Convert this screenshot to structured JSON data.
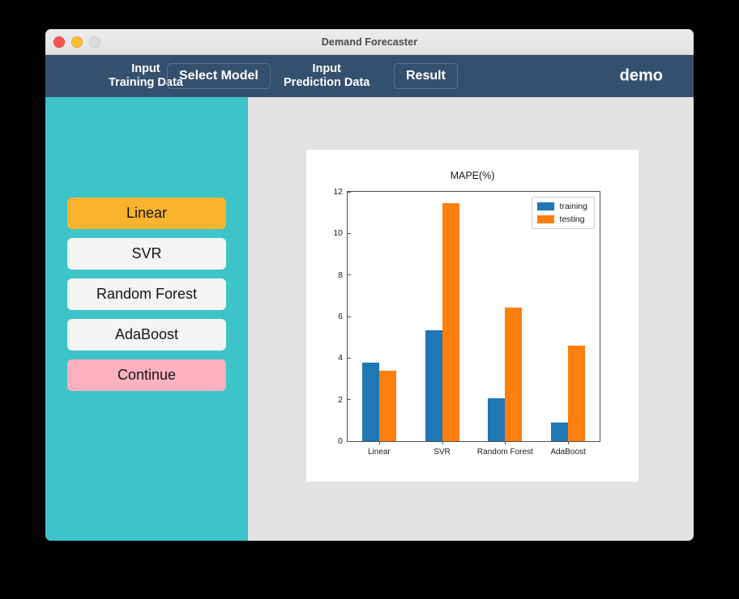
{
  "window": {
    "title": "Demand Forecaster",
    "traffic_lights": [
      "close",
      "minimize",
      "maximize"
    ]
  },
  "nav": {
    "input_training_data": "Input\nTraining Data",
    "select_model": "Select Model",
    "input_prediction_data": "Input\nPrediction Data",
    "result": "Result",
    "brand": "demo"
  },
  "sidebar": {
    "buttons": [
      {
        "label": "Linear",
        "state": "selected"
      },
      {
        "label": "SVR",
        "state": "normal"
      },
      {
        "label": "Random Forest",
        "state": "normal"
      },
      {
        "label": "AdaBoost",
        "state": "normal"
      },
      {
        "label": "Continue",
        "state": "continue"
      }
    ]
  },
  "colors": {
    "sidebar": "#3cc4c9",
    "navbar": "#35506e",
    "selected_button": "#f9b32f",
    "continue_button": "#fbb1c0",
    "normal_button": "#f4f4f4",
    "content_background": "#e2e2e2",
    "series_training": "#1f77b4",
    "series_testing": "#ff7f0e"
  },
  "chart_data": {
    "type": "bar",
    "title": "MAPE(%)",
    "xlabel": "",
    "ylabel": "",
    "ylim": [
      0,
      12
    ],
    "yticks": [
      0,
      2,
      4,
      6,
      8,
      10,
      12
    ],
    "grid": false,
    "legend_position": "upper right",
    "categories": [
      "Linear",
      "SVR",
      "Random Forest",
      "AdaBoost"
    ],
    "series": [
      {
        "name": "training",
        "color": "#1f77b4",
        "values": [
          3.77,
          5.35,
          2.05,
          0.88
        ]
      },
      {
        "name": "testing",
        "color": "#ff7f0e",
        "values": [
          3.4,
          11.47,
          6.42,
          4.6
        ]
      }
    ]
  }
}
